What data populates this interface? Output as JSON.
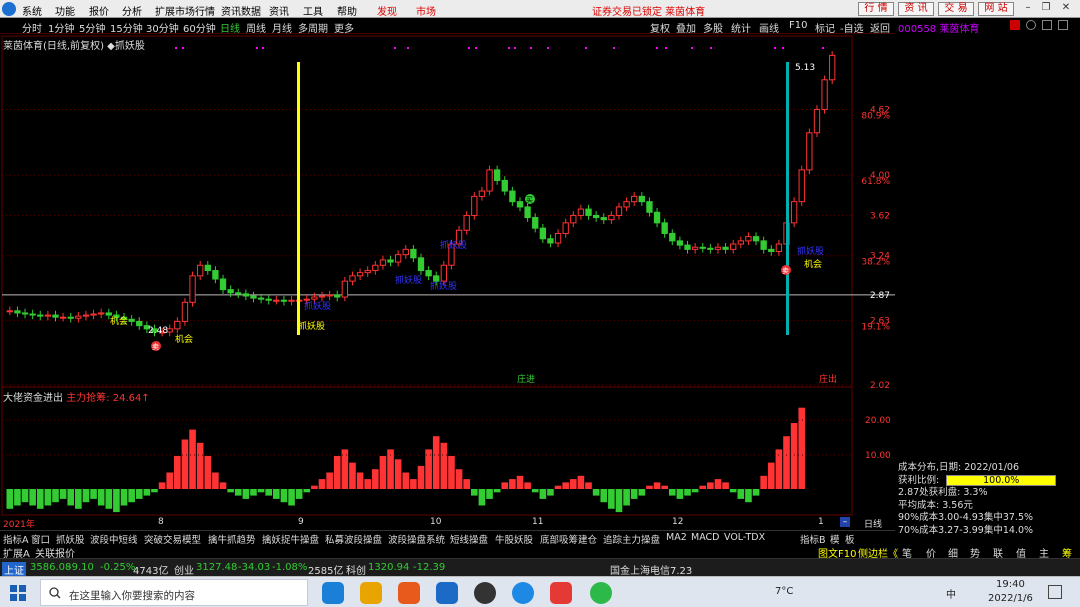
{
  "menu": {
    "items": [
      "系统",
      "功能",
      "报价",
      "分析",
      "扩展市场行情",
      "资讯数据",
      "资讯",
      "工具",
      "帮助"
    ],
    "hot": [
      "发现",
      "市场"
    ],
    "status": "证券交易已锁定 莱茵体育",
    "buttons": [
      "行 情",
      "资 讯",
      "交 易",
      "网 站"
    ]
  },
  "periods": [
    "分时",
    "1分钟",
    "5分钟",
    "15分钟",
    "30分钟",
    "60分钟",
    "日线",
    "周线",
    "月线",
    "多周期",
    "更多"
  ],
  "active_period": "日线",
  "toolbar": [
    "复权",
    "叠加",
    "多股",
    "统计",
    "画线",
    "F10",
    "标记",
    "-自选",
    "返回"
  ],
  "stock_title": "莱茵体育(日线,前复权) ◆抓妖股",
  "top_code": "000558 莱茵体育",
  "price_axis": [
    "4.62",
    "80.9%",
    "4.00",
    "61.8%",
    "3.62",
    "3.24",
    "38.2%",
    "2.87",
    "2.63",
    "19.1%",
    "2.02"
  ],
  "annotations": {
    "high": "5.13",
    "low": "2.48",
    "chance1": "机会",
    "chance2": "机会",
    "chance3": "机会",
    "zhuayao1": "抓妖股",
    "zhuayao2": "抓妖股",
    "zhuayao3": "抓妖股",
    "zhuayao4": "抓妖股",
    "zhuayao5": "抓妖股",
    "zhuayao6": "抓妖股",
    "sell": "卖",
    "buy_mark": "买",
    "zhuangjin": "庄进",
    "zhuangchu": "庄出"
  },
  "indicator": {
    "title": "大佬资金进出",
    "label": "主力抢筹:",
    "value": "24.64↑",
    "axis": [
      "20.00",
      "10.00"
    ]
  },
  "dates": [
    "2021年",
    "8",
    "9",
    "10",
    "11",
    "12",
    "1"
  ],
  "tabs": [
    "指标A",
    "窗口",
    "抓妖股",
    "波段中短线",
    "突破交易模型",
    "擒牛抓趋势",
    "擒妖捉牛操盘",
    "私募波段操盘",
    "波段操盘系统",
    "短线操盘",
    "牛股妖股",
    "底部吸筹建仓",
    "追踪主力操盘",
    "MA2",
    "MACD",
    "VOL-TDX"
  ],
  "right_tabs": [
    "指标B",
    "模",
    "板"
  ],
  "day_label": "日线",
  "extrabar": [
    "扩展A",
    "关联报价"
  ],
  "extrabar_right": [
    "图文F10",
    "侧边栏《",
    "笔",
    "价",
    "细",
    "势",
    "联",
    "值",
    "主",
    "筹"
  ],
  "ticker": {
    "sh_label": "上证",
    "sh_val": "3586.08",
    "sh_chg": "-9.10",
    "sh_pct": "-0.25%",
    "sh_amt": "4743亿",
    "cy_label": "创业",
    "cy_val": "3127.48",
    "cy_chg": "-34.03",
    "cy_pct": "-1.08%",
    "cy_amt": "2585亿",
    "kc_label": "科创",
    "kc_val": "1320.94",
    "kc_chg": "-12.39",
    "news": "国金上海电信7.23"
  },
  "chips": {
    "title": "成本分布,日期: 2022/01/06",
    "profit_label": "获利比例:",
    "profit_val": "100.0%",
    "line2": "2.87处获利盘: 3.3%",
    "line3": "平均成本: 3.56元",
    "line4": "90%成本3.00-4.93集中37.5%",
    "line5": "70%成本3.27-3.99集中14.0%"
  },
  "taskbar": {
    "search_placeholder": "在这里输入你要搜索的内容",
    "weather": "7°C",
    "time": "19:40",
    "date": "2022/1/6",
    "ime": "中"
  },
  "colors": {
    "up": "#ff3333",
    "down": "#33cc33",
    "yellow": "#ffff00",
    "cyan": "#00b0b0"
  },
  "chart_data": {
    "type": "candlestick",
    "title": "莱茵体育(日线,前复权)",
    "ylim": [
      2.02,
      5.2
    ],
    "ticks": [
      2.02,
      2.63,
      2.87,
      3.24,
      3.62,
      4.0,
      4.62
    ],
    "closes": [
      2.72,
      2.7,
      2.69,
      2.68,
      2.67,
      2.68,
      2.66,
      2.66,
      2.65,
      2.67,
      2.68,
      2.69,
      2.7,
      2.68,
      2.66,
      2.64,
      2.62,
      2.58,
      2.55,
      2.52,
      2.52,
      2.55,
      2.62,
      2.8,
      3.05,
      3.15,
      3.1,
      3.02,
      2.92,
      2.89,
      2.88,
      2.86,
      2.84,
      2.83,
      2.82,
      2.82,
      2.81,
      2.82,
      2.82,
      2.83,
      2.85,
      2.86,
      2.87,
      2.85,
      3.0,
      3.05,
      3.08,
      3.1,
      3.15,
      3.2,
      3.18,
      3.25,
      3.3,
      3.22,
      3.1,
      3.05,
      3.0,
      3.15,
      3.35,
      3.48,
      3.62,
      3.8,
      3.85,
      4.05,
      3.95,
      3.85,
      3.75,
      3.7,
      3.6,
      3.5,
      3.4,
      3.36,
      3.45,
      3.55,
      3.62,
      3.68,
      3.62,
      3.6,
      3.58,
      3.62,
      3.7,
      3.75,
      3.8,
      3.75,
      3.65,
      3.55,
      3.45,
      3.38,
      3.34,
      3.3,
      3.32,
      3.31,
      3.3,
      3.32,
      3.3,
      3.35,
      3.38,
      3.42,
      3.38,
      3.3,
      3.28,
      3.35,
      3.55,
      3.75,
      4.05,
      4.4,
      4.62,
      4.9,
      5.13
    ],
    "indicator": [
      -6,
      -5,
      -4,
      -5,
      -6,
      -5,
      -4,
      -3,
      -5,
      -6,
      -4,
      -3,
      -5,
      -6,
      -7,
      -5,
      -4,
      -3,
      -2,
      -1,
      2,
      5,
      10,
      15,
      18,
      14,
      10,
      5,
      2,
      -1,
      -2,
      -3,
      -2,
      -1,
      -2,
      -3,
      -4,
      -5,
      -3,
      -1,
      1,
      3,
      5,
      10,
      12,
      8,
      5,
      3,
      6,
      10,
      12,
      9,
      5,
      3,
      7,
      12,
      16,
      14,
      10,
      6,
      3,
      -2,
      -5,
      -3,
      -1,
      2,
      3,
      4,
      2,
      -1,
      -3,
      -2,
      1,
      2,
      3,
      4,
      2,
      -2,
      -4,
      -6,
      -7,
      -5,
      -3,
      -2,
      1,
      2,
      1,
      -2,
      -3,
      -2,
      -1,
      1,
      2,
      3,
      2,
      -1,
      -3,
      -4,
      -2,
      4,
      8,
      12,
      16,
      20,
      24.64
    ]
  }
}
